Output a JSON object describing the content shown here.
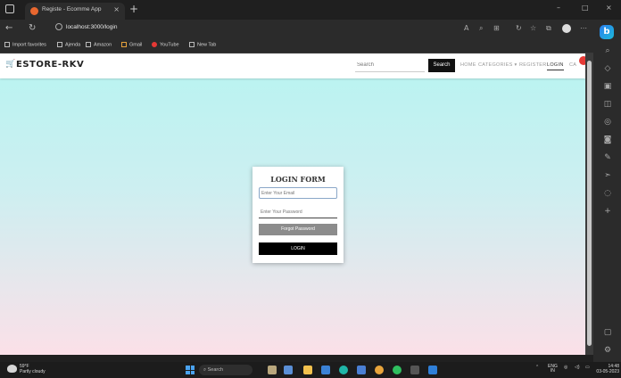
{
  "browser": {
    "tab_title": "Registe - Ecomme App",
    "tab_close": "×",
    "new_tab": "+",
    "url": "localhost:3000/login",
    "window_controls": [
      "–",
      "□",
      "×"
    ]
  },
  "bookmarks": [
    {
      "label": "Import favorites",
      "icon": "import-icon"
    },
    {
      "label": "Ajenda",
      "icon": "page-icon"
    },
    {
      "label": "Amazon",
      "icon": "page-icon"
    },
    {
      "label": "Gmail",
      "icon": "gmail-icon"
    },
    {
      "label": "YouTube",
      "icon": "youtube-icon"
    },
    {
      "label": "New Tab",
      "icon": "page-icon"
    }
  ],
  "navbar": {
    "brand": "ESTORE-RKV",
    "search_placeholder": "Search",
    "search_button": "Search",
    "links": [
      "HOME",
      "CATEGORIES ▾",
      "REGISTER",
      "LOGIN",
      "CA"
    ],
    "active_link": "LOGIN"
  },
  "login_form": {
    "title": "LOGIN FORM",
    "email_placeholder": "Enter Your Email",
    "password_placeholder": "Enter Your Password",
    "forgot_button": "Forgot Password",
    "login_button": "LOGIN"
  },
  "taskbar": {
    "weather_temp": "59°F",
    "weather_desc": "Partly cloudy",
    "search_label": "Search",
    "lang": "ENG",
    "lang_sub": "IN",
    "time": "14:48",
    "date": "03-05-2023"
  },
  "colors": {
    "page_gradient_top": "#b7f4f1",
    "page_gradient_bottom": "#fbe0e8",
    "login_button": "#000000",
    "forgot_button": "#8c8c8c",
    "cart_badge": "#e53935"
  }
}
